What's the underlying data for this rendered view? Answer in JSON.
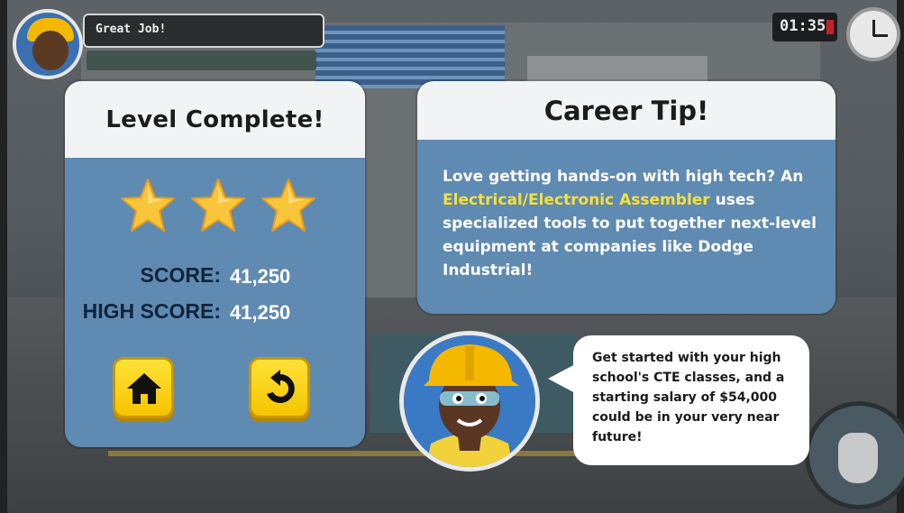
{
  "hud": {
    "message": "Great Job!",
    "timer": "01:35"
  },
  "level_panel": {
    "title": "Level Complete!",
    "stars_earned": 3,
    "stars_total": 3,
    "score_label": "SCORE:",
    "score_value": "41,250",
    "high_score_label": "HIGH SCORE:",
    "high_score_value": "41,250",
    "buttons": [
      {
        "name": "home",
        "icon": "home-icon"
      },
      {
        "name": "replay",
        "icon": "replay-icon"
      }
    ]
  },
  "career_panel": {
    "title": "Career Tip!",
    "text_1": "Love getting hands-on with high tech? An ",
    "highlight": "Electrical/Electronic Assembler",
    "text_2": " uses specialized tools to put together next-level equipment at companies like ",
    "company": "Dodge Industrial",
    "text_3": "!"
  },
  "bubble": {
    "text_1": "Get started with your high school's CTE classes, and a starting salary of ",
    "salary": "$54,000",
    "text_2": " could be in your very near future!"
  },
  "colors": {
    "panel_blue": "#5f8ab2",
    "header_white": "#f1f3f4",
    "highlight_yellow": "#f6e03a",
    "button_yellow": "#f5c400",
    "star_gold": "#f9c53a"
  }
}
